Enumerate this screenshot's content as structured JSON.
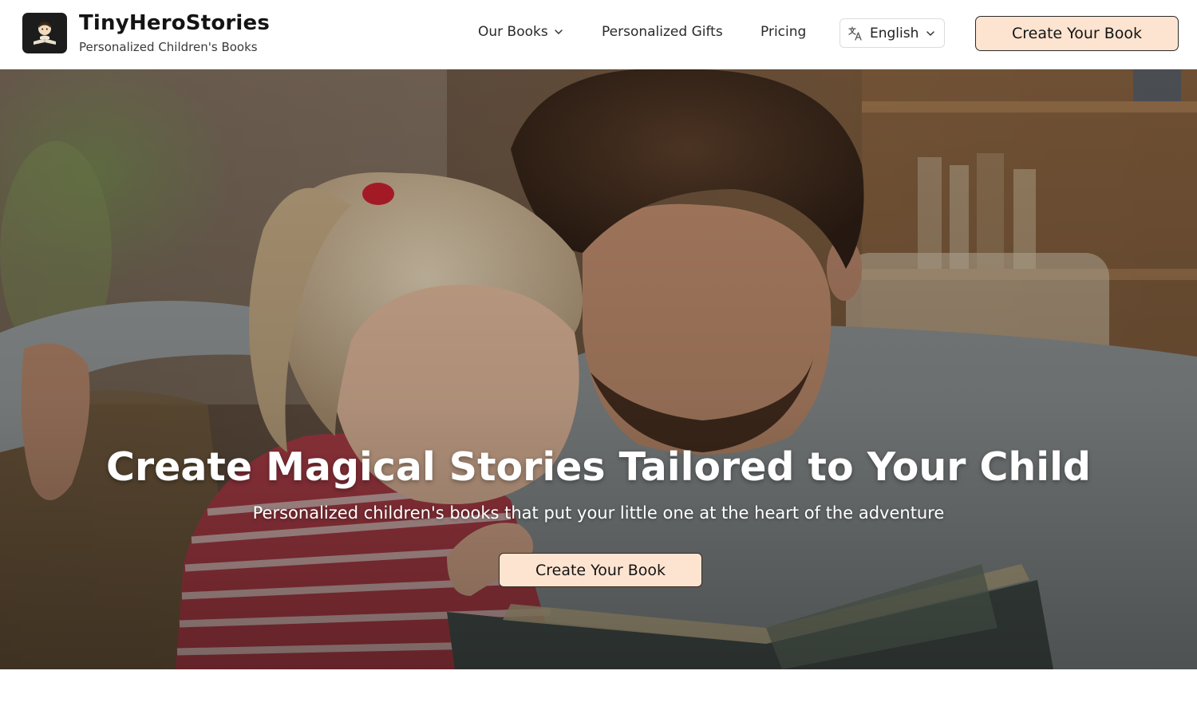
{
  "brand": {
    "name": "TinyHeroStories",
    "tagline": "Personalized Children's Books",
    "logo_icon": "child-reading-book-icon"
  },
  "nav": {
    "items": [
      {
        "label": "Our Books",
        "has_dropdown": true
      },
      {
        "label": "Personalized Gifts",
        "has_dropdown": false
      },
      {
        "label": "Pricing",
        "has_dropdown": false
      }
    ],
    "language": {
      "selected": "English",
      "icon": "translate-icon"
    },
    "cta_label": "Create Your Book"
  },
  "hero": {
    "title": "Create Magical Stories Tailored to Your Child",
    "subtitle": "Personalized children's books that put your little one at the heart of the adventure",
    "cta_label": "Create Your Book"
  },
  "colors": {
    "cta_background": "#fde4d1",
    "text_dark": "#141414",
    "header_bg": "#ffffff"
  }
}
